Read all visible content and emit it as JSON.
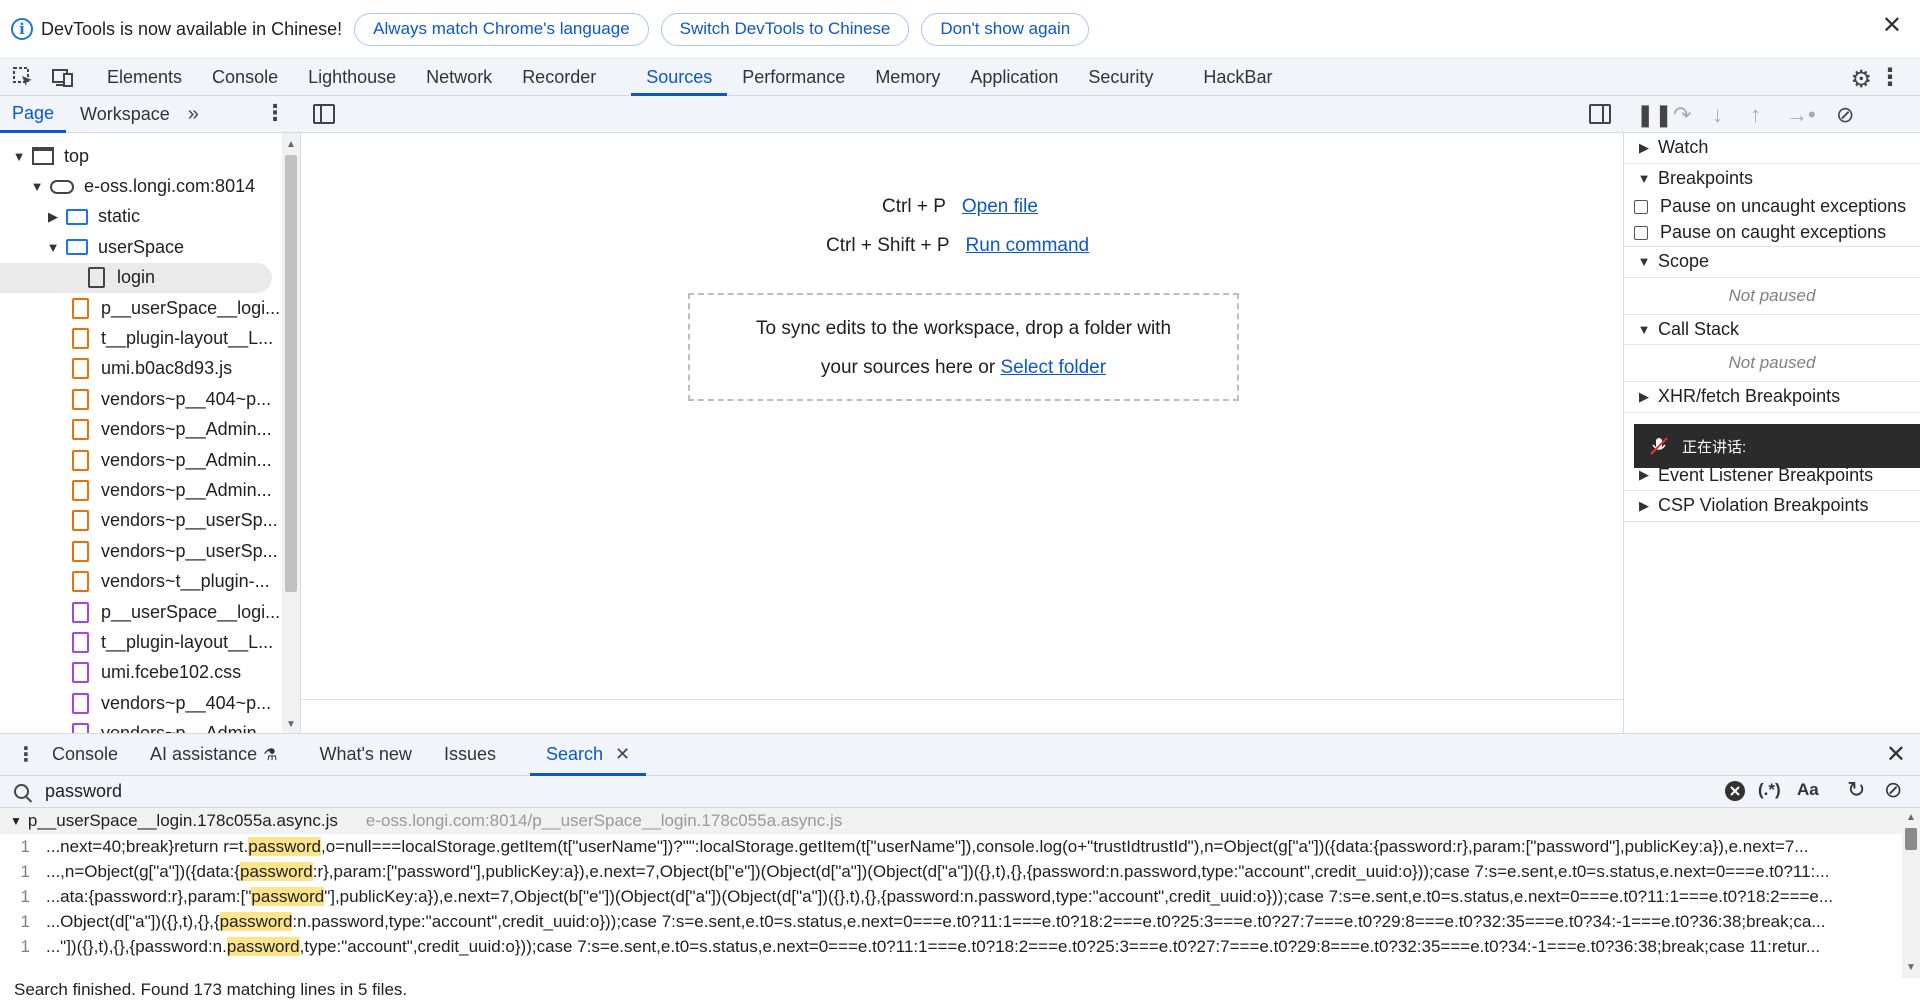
{
  "infobar": {
    "message": "DevTools is now available in Chinese!",
    "buttons": [
      "Always match Chrome's language",
      "Switch DevTools to Chinese",
      "Don't show again"
    ]
  },
  "main_tabs": [
    "Elements",
    "Console",
    "Lighthouse",
    "Network",
    "Recorder",
    "Sources",
    "Performance",
    "Memory",
    "Application",
    "Security",
    "HackBar"
  ],
  "active_main_tab": "Sources",
  "navigator": {
    "tabs": [
      "Page",
      "Workspace"
    ],
    "tree": [
      {
        "label": "top",
        "kind": "frame"
      },
      {
        "label": "e-oss.longi.com:8014",
        "kind": "cloud"
      },
      {
        "label": "static",
        "kind": "folder"
      },
      {
        "label": "userSpace",
        "kind": "folder"
      },
      {
        "label": "login",
        "kind": "doc"
      },
      {
        "label": "p__userSpace__logi...",
        "kind": "js"
      },
      {
        "label": "t__plugin-layout__L...",
        "kind": "js"
      },
      {
        "label": "umi.b0ac8d93.js",
        "kind": "js"
      },
      {
        "label": "vendors~p__404~p...",
        "kind": "js"
      },
      {
        "label": "vendors~p__Admin...",
        "kind": "js"
      },
      {
        "label": "vendors~p__Admin...",
        "kind": "js"
      },
      {
        "label": "vendors~p__Admin...",
        "kind": "js"
      },
      {
        "label": "vendors~p__userSp...",
        "kind": "js"
      },
      {
        "label": "vendors~p__userSp...",
        "kind": "js"
      },
      {
        "label": "vendors~t__plugin-...",
        "kind": "js"
      },
      {
        "label": "p__userSpace__logi...",
        "kind": "css"
      },
      {
        "label": "t__plugin-layout__L...",
        "kind": "css"
      },
      {
        "label": "umi.fcebe102.css",
        "kind": "css"
      },
      {
        "label": "vendors~p__404~p...",
        "kind": "css"
      },
      {
        "label": "vendors~p__Admin...",
        "kind": "css"
      }
    ]
  },
  "editor": {
    "open_file_keys": "Ctrl + P",
    "open_file_label": "Open file",
    "run_command_keys": "Ctrl + Shift + P",
    "run_command_label": "Run command",
    "drop_text_1": "To sync edits to the workspace, drop a folder with",
    "drop_text_2": "your sources here or",
    "select_folder": "Select folder"
  },
  "debugger": {
    "sections": {
      "watch": "Watch",
      "breakpoints": "Breakpoints",
      "pause_uncaught": "Pause on uncaught exceptions",
      "pause_caught": "Pause on caught exceptions",
      "scope": "Scope",
      "scope_status": "Not paused",
      "call_stack": "Call Stack",
      "call_stack_status": "Not paused",
      "xhr": "XHR/fetch Breakpoints",
      "event_listener": "Event Listener Breakpoints",
      "csp": "CSP Violation Breakpoints"
    },
    "overlay_text": "正在讲话:"
  },
  "drawer": {
    "tabs": [
      "Console",
      "AI assistance",
      "What's new",
      "Issues",
      "Search"
    ],
    "active_tab": "Search",
    "query": "password",
    "regex_label": "(.*)",
    "case_label": "Aa",
    "file_name": "p__userSpace__login.178c055a.async.js",
    "file_path": "e-oss.longi.com:8014/p__userSpace__login.178c055a.async.js",
    "lines": [
      {
        "num": "1",
        "pre": "...next=40;break}return r=t.",
        "match": "password",
        "post": ",o=null===localStorage.getItem(t[\"userName\"])?\"\":localStorage.getItem(t[\"userName\"]),console.log(o+\"trustIdtrustId\"),n=Object(g[\"a\"])({data:{password:r},param:[\"password\"],publicKey:a}),e.next=7..."
      },
      {
        "num": "1",
        "pre": "...,n=Object(g[\"a\"])({data:{",
        "match": "password",
        "post": ":r},param:[\"password\"],publicKey:a}),e.next=7,Object(b[\"e\"])(Object(d[\"a\"])(Object(d[\"a\"])({},t),{},{password:n.password,type:\"account\",credit_uuid:o}));case 7:s=e.sent,e.t0=s.status,e.next=0===e.t0?11:..."
      },
      {
        "num": "1",
        "pre": "...ata:{password:r},param:[\"",
        "match": "password",
        "post": "\"],publicKey:a}),e.next=7,Object(b[\"e\"])(Object(d[\"a\"])(Object(d[\"a\"])({},t),{},{password:n.password,type:\"account\",credit_uuid:o}));case 7:s=e.sent,e.t0=s.status,e.next=0===e.t0?11:1===e.t0?18:2===e..."
      },
      {
        "num": "1",
        "pre": "...Object(d[\"a\"])({},t),{},{",
        "match": "password",
        "post": ":n.password,type:\"account\",credit_uuid:o}));case 7:s=e.sent,e.t0=s.status,e.next=0===e.t0?11:1===e.t0?18:2===e.t0?25:3===e.t0?27:7===e.t0?29:8===e.t0?32:35===e.t0?34:-1===e.t0?36:38;break;ca..."
      },
      {
        "num": "1",
        "pre": "...\"])({},t),{},{password:n.",
        "match": "password",
        "post": ",type:\"account\",credit_uuid:o}));case 7:s=e.sent,e.t0=s.status,e.next=0===e.t0?11:1===e.t0?18:2===e.t0?25:3===e.t0?27:7===e.t0?29:8===e.t0?32:35===e.t0?34:-1===e.t0?36:38;break;case 11:retur..."
      }
    ],
    "status": "Search finished.  Found 173 matching lines in 5 files."
  }
}
